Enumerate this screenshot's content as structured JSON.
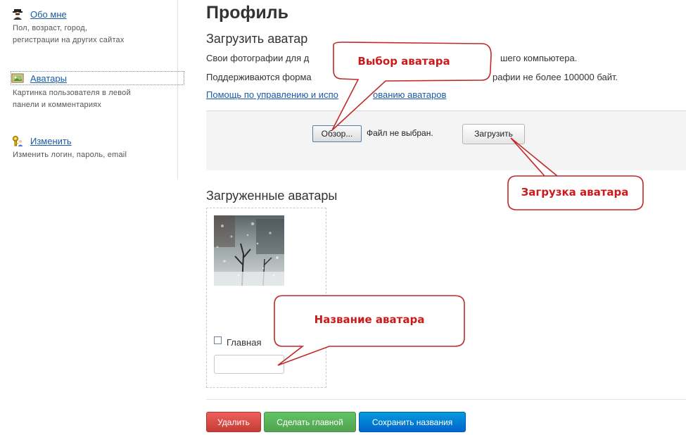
{
  "sidebar": {
    "items": [
      {
        "label": "Обо мне",
        "icon": "spy-user-icon",
        "desc": "Пол, возраст, город, регистрации на других сайтах"
      },
      {
        "label": "Аватары",
        "icon": "picture-icon",
        "desc": "Картинка пользователя в левой панели и комментариях"
      },
      {
        "label": "Изменить",
        "icon": "key-user-icon",
        "desc": "Изменить логин, пароль, email"
      }
    ]
  },
  "main": {
    "title": "Профиль",
    "upload_heading": "Загрузить аватар",
    "para1": "Свои фотографии для д",
    "para1_end": "шего компьютера.",
    "para2": "Поддерживаются форма",
    "para2_end": "рафии не более 100000 байт.",
    "help_link_start": "Помощь по управлению и испо",
    "help_link_end": "ованию аватаров",
    "browse_button": "Обзор...",
    "file_status": "Файл не выбран.",
    "upload_button": "Загрузить",
    "uploaded_heading": "Загруженные аватары",
    "main_checkbox_label": "Главная",
    "name_input_value": "",
    "delete_button": "Удалить",
    "make_main_button": "Сделать главной",
    "save_names_button": "Сохранить названия"
  },
  "callouts": {
    "choose": "Выбор аватара",
    "upload": "Загрузка аватара",
    "name": "Название аватара"
  },
  "colors": {
    "callout_text": "#cc1a1a",
    "callout_border": "#c0292a",
    "link": "#1a5aa6"
  }
}
